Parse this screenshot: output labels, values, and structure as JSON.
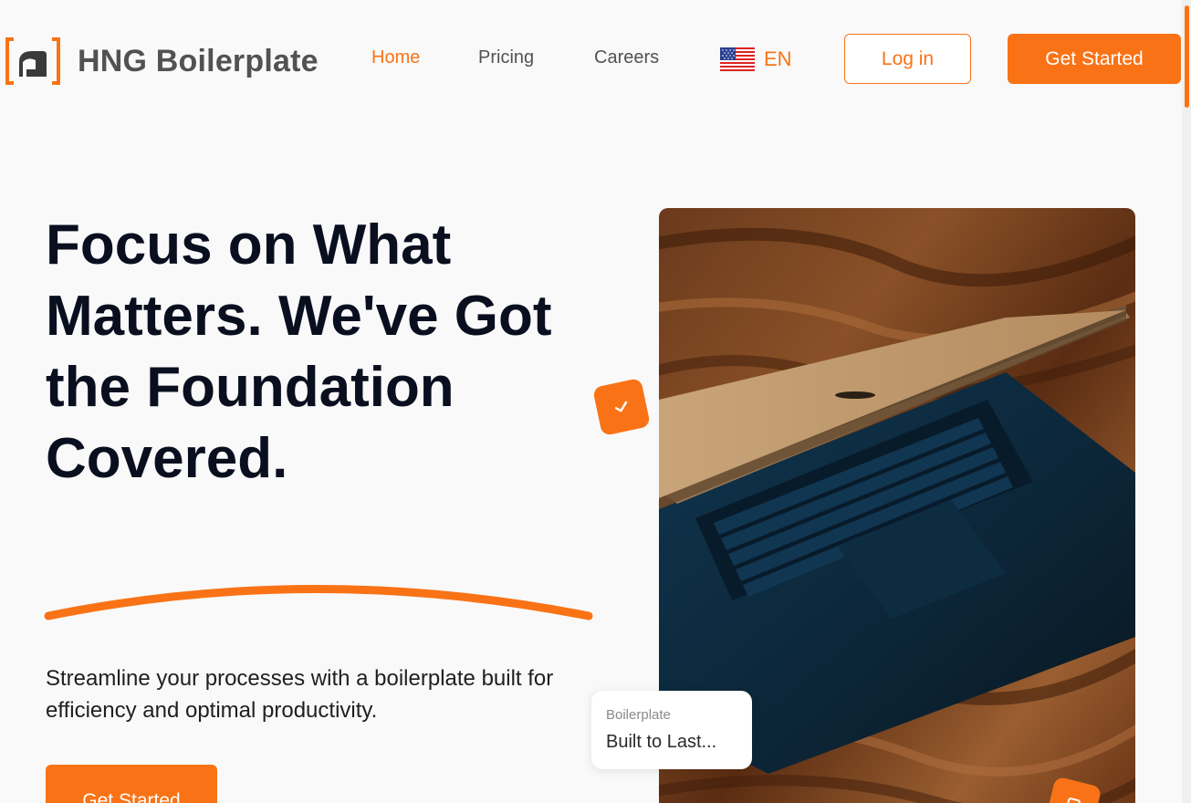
{
  "brand": {
    "name": "HNG Boilerplate",
    "accent": "#f97316"
  },
  "nav": {
    "items": [
      {
        "label": "Home",
        "active": true
      },
      {
        "label": "Pricing",
        "active": false
      },
      {
        "label": "Careers",
        "active": false
      }
    ],
    "language": {
      "code": "EN",
      "flag": "us-flag-icon"
    },
    "login_label": "Log in",
    "get_started_label": "Get Started"
  },
  "hero": {
    "title": "Focus on What Matters. We've Got the Foundation Covered.",
    "subtitle": "Streamline your processes with a boilerplate built for efficiency and optimal productivity.",
    "cta_label": "Get Started"
  },
  "card": {
    "label": "Boilerplate",
    "value": "Built to Last..."
  }
}
